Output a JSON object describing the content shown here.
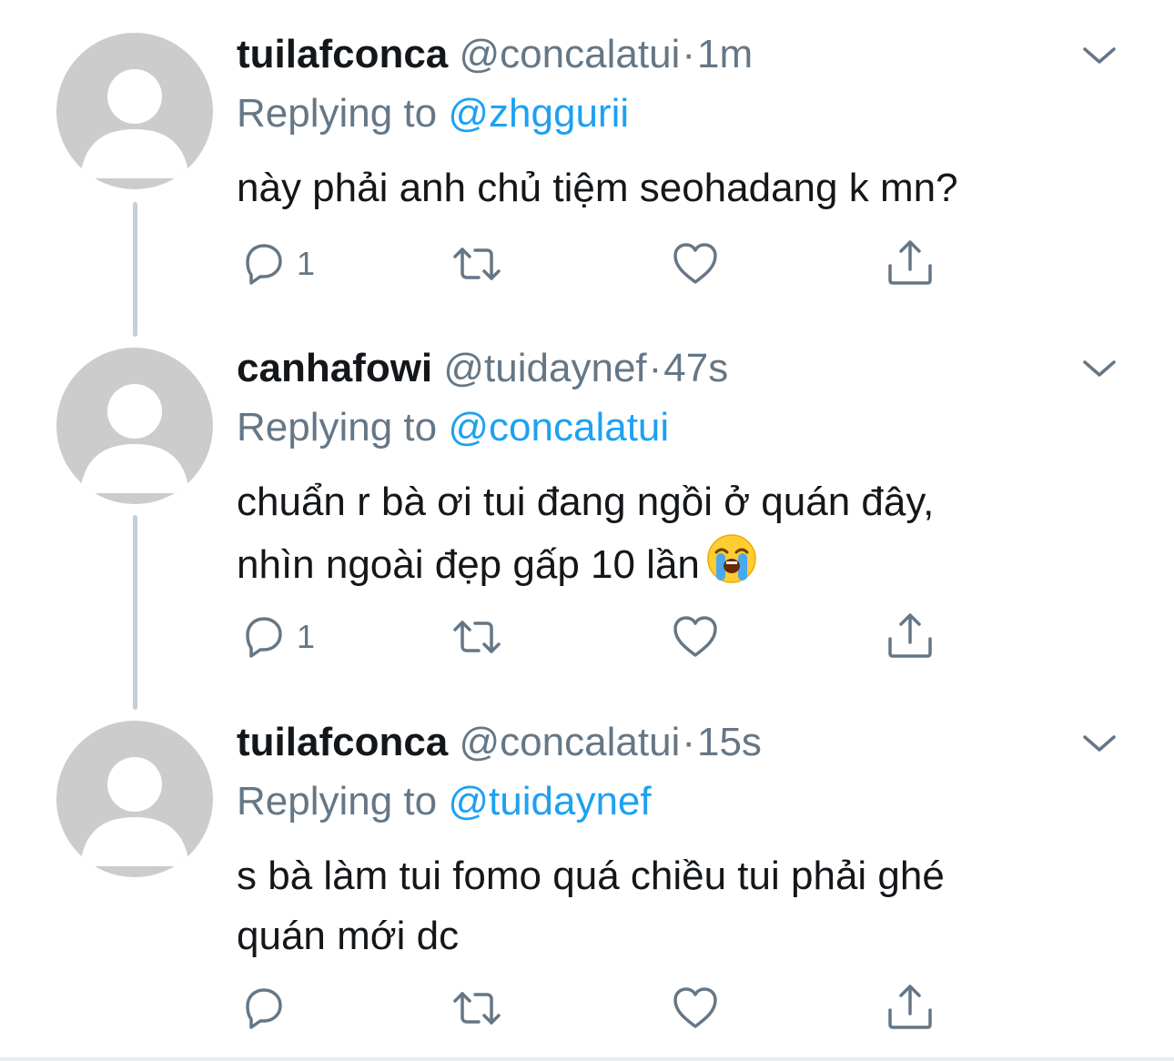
{
  "tweets": [
    {
      "name": "tuilafconca",
      "handle": "@concalatui",
      "separator": "·",
      "time": "1m",
      "replying_prefix": "Replying to",
      "replying_to": "@zhggurii",
      "text_lines": [
        "này phải anh chủ tiệm seohadang k mn?"
      ],
      "reply_count": "1",
      "retweet_count": "",
      "like_count": ""
    },
    {
      "name": "canhafowi",
      "handle": "@tuidaynef",
      "separator": "·",
      "time": "47s",
      "replying_prefix": "Replying to",
      "replying_to": "@concalatui",
      "text_lines": [
        "chuẩn r bà ơi tui đang ngồi ở quán đây,",
        "nhìn ngoài đẹp gấp 10 lần"
      ],
      "emoji": "loudly-crying-face",
      "reply_count": "1",
      "retweet_count": "",
      "like_count": ""
    },
    {
      "name": "tuilafconca",
      "handle": "@concalatui",
      "separator": "·",
      "time": "15s",
      "replying_prefix": "Replying to",
      "replying_to": "@tuidaynef",
      "text_lines": [
        "s bà làm tui fomo quá chiều tui phải ghé",
        "quán mới dc"
      ],
      "reply_count": "",
      "retweet_count": "",
      "like_count": ""
    }
  ],
  "colors": {
    "name": "#14171a",
    "secondary": "#657786",
    "mention": "#1da1f2",
    "avatar_bg": "#cccccc",
    "thread_line": "#c4cfd6",
    "icon": "#657786"
  },
  "icons": [
    "chevron-down-icon",
    "reply-icon",
    "retweet-icon",
    "like-icon",
    "share-icon",
    "default-avatar-icon"
  ]
}
